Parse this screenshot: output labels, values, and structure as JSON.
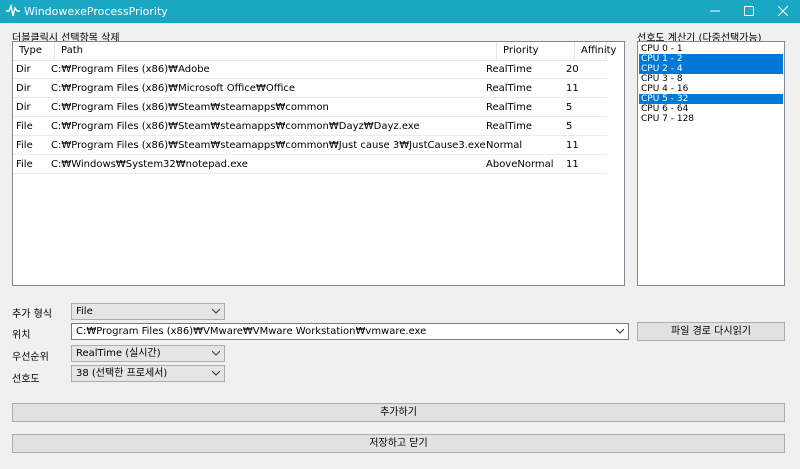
{
  "window": {
    "title": "WindowexeProcessPriority"
  },
  "list_section": {
    "label": "더블클릭시 선택항목 삭제",
    "columns": [
      "Type",
      "Path",
      "Priority",
      "Affinity"
    ],
    "rows": [
      {
        "type": "Dir",
        "path": "C:₩Program Files (x86)₩Adobe",
        "priority": "RealTime",
        "affinity": "20"
      },
      {
        "type": "Dir",
        "path": "C:₩Program Files (x86)₩Microsoft Office₩Office",
        "priority": "RealTime",
        "affinity": "11"
      },
      {
        "type": "Dir",
        "path": "C:₩Program Files (x86)₩Steam₩steamapps₩common",
        "priority": "RealTime",
        "affinity": "5"
      },
      {
        "type": "File",
        "path": "C:₩Program Files (x86)₩Steam₩steamapps₩common₩Dayz₩Dayz.exe",
        "priority": "RealTime",
        "affinity": "5"
      },
      {
        "type": "File",
        "path": "C:₩Program Files (x86)₩Steam₩steamapps₩common₩Just cause 3₩JustCause3.exe",
        "priority": "Normal",
        "affinity": "11"
      },
      {
        "type": "File",
        "path": "C:₩Windows₩System32₩notepad.exe",
        "priority": "AboveNormal",
        "affinity": "11"
      }
    ]
  },
  "affinity_section": {
    "label": "선호도 계산기 (다중선택가능)",
    "items": [
      {
        "label": "CPU 0 - 1",
        "selected": false
      },
      {
        "label": "CPU 1 - 2",
        "selected": true
      },
      {
        "label": "CPU 2 - 4",
        "selected": true
      },
      {
        "label": "CPU 3 - 8",
        "selected": false
      },
      {
        "label": "CPU 4 - 16",
        "selected": false
      },
      {
        "label": "CPU 5 - 32",
        "selected": true
      },
      {
        "label": "CPU 6 - 64",
        "selected": false
      },
      {
        "label": "CPU 7 - 128",
        "selected": false
      }
    ]
  },
  "form": {
    "add_type": {
      "label": "추가 형식",
      "value": "File"
    },
    "location": {
      "label": "위치",
      "value": "C:₩Program Files (x86)₩VMware₩VMware Workstation₩vmware.exe"
    },
    "reload_button": "파일 경로 다시읽기",
    "priority": {
      "label": "우선순위",
      "value": "RealTime (실시간)"
    },
    "affinity": {
      "label": "선호도",
      "value": "38 (선택한 프로세서)"
    }
  },
  "buttons": {
    "add": "추가하기",
    "save_close": "저장하고 닫기"
  },
  "colors": {
    "titlebar": "#1aa7c4",
    "selection": "#0078d7"
  }
}
